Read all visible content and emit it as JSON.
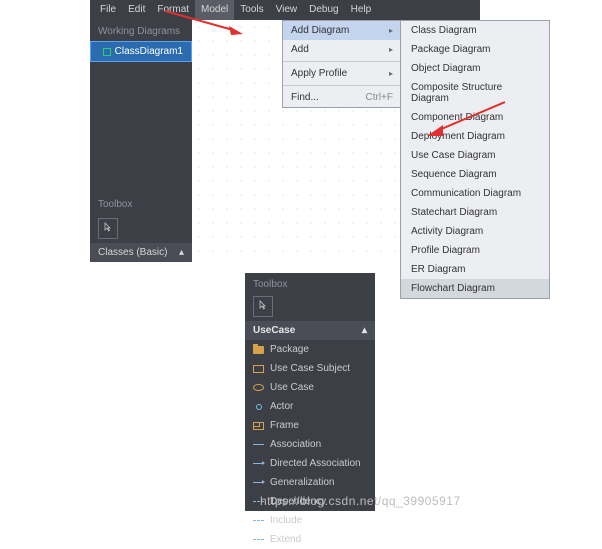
{
  "menubar": [
    "File",
    "Edit",
    "Format",
    "Model",
    "Tools",
    "View",
    "Debug",
    "Help"
  ],
  "sidebar": {
    "title": "Working Diagrams",
    "active_item": "ClassDiagram1",
    "toolbox_label": "Toolbox",
    "classes_label": "Classes (Basic)"
  },
  "menu1": {
    "items": [
      {
        "label": "Add Diagram",
        "sub": true,
        "hi": true
      },
      {
        "label": "Add",
        "sub": true
      },
      {
        "sep": true
      },
      {
        "label": "Apply Profile",
        "sub": true
      },
      {
        "sep": true
      },
      {
        "label": "Find...",
        "shortcut": "Ctrl+F"
      }
    ]
  },
  "menu2": {
    "items": [
      "Class Diagram",
      "Package Diagram",
      "Object Diagram",
      "Composite Structure Diagram",
      "Component Diagram",
      "Deployment Diagram",
      "Use Case Diagram",
      "Sequence Diagram",
      "Communication Diagram",
      "Statechart Diagram",
      "Activity Diagram",
      "Profile Diagram",
      "ER Diagram",
      "Flowchart Diagram"
    ]
  },
  "toolbox": {
    "header": "Toolbox",
    "section": "UseCase",
    "items": [
      {
        "icon": "folder",
        "label": "Package"
      },
      {
        "icon": "rect",
        "label": "Use Case Subject"
      },
      {
        "icon": "oval",
        "label": "Use Case"
      },
      {
        "icon": "actor",
        "label": "Actor"
      },
      {
        "icon": "frame",
        "label": "Frame"
      },
      {
        "icon": "line",
        "label": "Association"
      },
      {
        "icon": "arrow-r",
        "label": "Directed Association"
      },
      {
        "icon": "gen",
        "label": "Generalization"
      },
      {
        "icon": "dash",
        "label": "Dependency"
      },
      {
        "icon": "dash",
        "label": "Include"
      },
      {
        "icon": "dash",
        "label": "Extend"
      }
    ]
  },
  "watermark": "https://blog.csdn.net/qq_39905917"
}
